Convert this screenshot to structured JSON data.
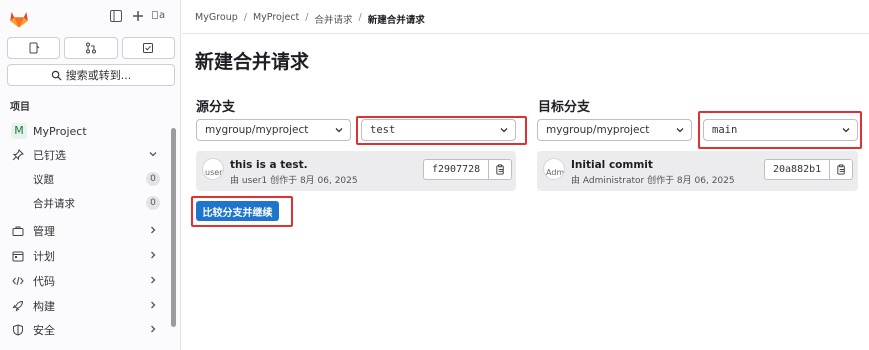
{
  "sidebar": {
    "search_label": "搜索或转到...",
    "section_label": "项目",
    "project_badge": "M",
    "project_name": "MyProject",
    "pinned_label": "已钉选",
    "pinned_items": [
      {
        "label": "议题",
        "count": "0"
      },
      {
        "label": "合并请求",
        "count": "0"
      }
    ],
    "nav_items": [
      {
        "label": "管理",
        "icon": "briefcase-icon"
      },
      {
        "label": "计划",
        "icon": "calendar-icon"
      },
      {
        "label": "代码",
        "icon": "code-icon"
      },
      {
        "label": "构建",
        "icon": "rocket-icon"
      },
      {
        "label": "安全",
        "icon": "shield-icon"
      }
    ],
    "avatar_text": "a"
  },
  "breadcrumb": {
    "items": [
      "MyGroup",
      "MyProject",
      "合并请求",
      "新建合并请求"
    ],
    "separator": "/"
  },
  "page_title": "新建合并请求",
  "source": {
    "title": "源分支",
    "project": "mygroup/myproject",
    "branch": "test",
    "commit": {
      "title": "this is a test.",
      "avatar_alt": "user",
      "meta": "由 user1 创作于 8月 06, 2025",
      "sha": "f2907728"
    }
  },
  "target": {
    "title": "目标分支",
    "project": "mygroup/myproject",
    "branch": "main",
    "commit": {
      "title": "Initial commit",
      "avatar_alt": "Adm",
      "meta": "由 Administrator 创作于 8月 06, 2025",
      "sha": "20a882b1"
    }
  },
  "compare_button": "比较分支并继续",
  "colors": {
    "accent": "#1f75cb",
    "highlight": "#e03131",
    "logo": "#e24329"
  }
}
